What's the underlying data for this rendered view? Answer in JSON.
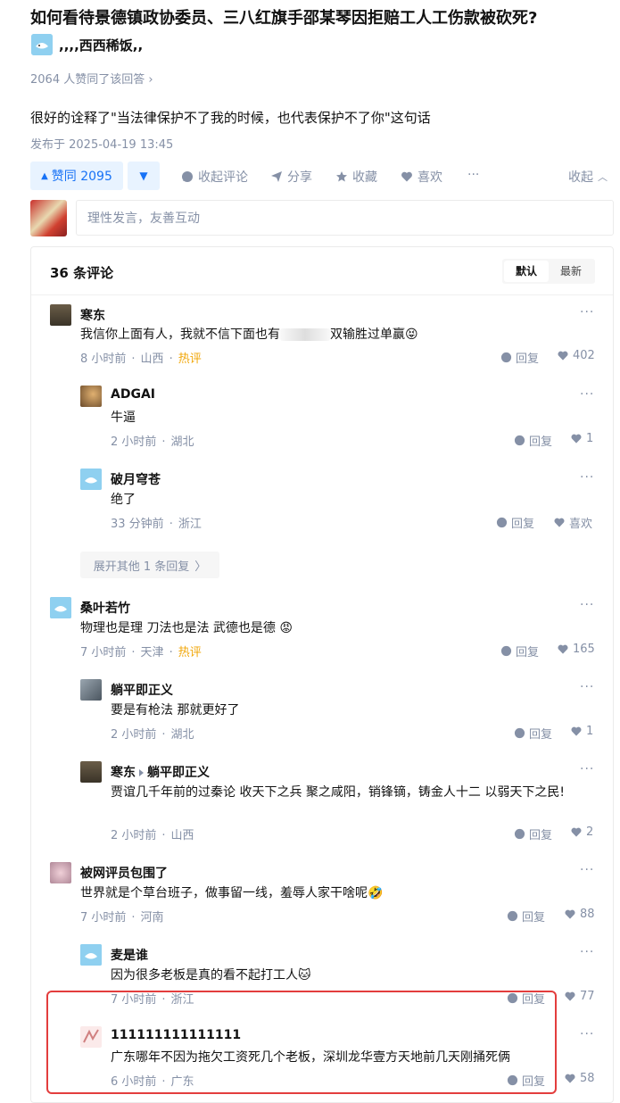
{
  "question": {
    "title": "如何看待景德镇政协委员、三八红旗手邵某琴因拒赔工人工伤款被砍死?"
  },
  "answer": {
    "author": ",,,,西西稀饭,,",
    "likes_line": "2064 人赞同了该回答",
    "content": "很好的诠释了\"当法律保护不了我的时候，也代表保护不了你\"这句话",
    "published": "发布于 2025-04-19 13:45"
  },
  "actions": {
    "vote_up": "赞同 2095",
    "collapse_comments": "收起评论",
    "share": "分享",
    "favorite": "收藏",
    "like": "喜欢",
    "more": "···",
    "fold": "收起"
  },
  "comment_input": {
    "placeholder": "理性发言，友善互动"
  },
  "comments_header": {
    "count_label": "36 条评论",
    "sort_default": "默认",
    "sort_latest": "最新"
  },
  "comments": [
    {
      "name": "寒东",
      "text_before": "我信你上面有人，我就不信下面也有",
      "text_after": "双输胜过单赢",
      "emoji": "😝",
      "time": "8 小时前",
      "region": "山西",
      "tag": "热评",
      "reply": "回复",
      "likes": "402",
      "more": "···"
    },
    {
      "name": "ADGAI",
      "text": "牛逼",
      "time": "2 小时前",
      "region": "湖北",
      "reply": "回复",
      "likes": "1",
      "more": "···"
    },
    {
      "name": "破月穹苍",
      "text": "绝了",
      "time": "33 分钟前",
      "region": "浙江",
      "reply": "回复",
      "likes": "喜欢",
      "more": "···"
    },
    {
      "expand": "展开其他 1 条回复"
    },
    {
      "name": "桑叶若竹",
      "text": "物理也是理 刀法也是法 武德也是德",
      "emoji": "😡",
      "time": "7 小时前",
      "region": "天津",
      "tag": "热评",
      "reply": "回复",
      "likes": "165",
      "more": "···"
    },
    {
      "name": "躺平即正义",
      "text": "要是有枪法 那就更好了",
      "time": "2 小时前",
      "region": "湖北",
      "reply": "回复",
      "likes": "1",
      "more": "···"
    },
    {
      "name": "寒东",
      "reply_to": "躺平即正义",
      "text": "贾谊几千年前的过秦论 收天下之兵 聚之咸阳，销锋镝，铸金人十二 以弱天下之民!",
      "time": "2 小时前",
      "region": "山西",
      "reply": "回复",
      "likes": "2",
      "more": "···"
    },
    {
      "name": "被网评员包围了",
      "text": "世界就是个草台班子，做事留一线，羞辱人家干啥呢",
      "emoji": "🤣",
      "time": "7 小时前",
      "region": "河南",
      "reply": "回复",
      "likes": "88",
      "more": "···"
    },
    {
      "name": "麦是谁",
      "text": "因为很多老板是真的看不起打工人",
      "emoji": "🐱",
      "time": "7 小时前",
      "region": "浙江",
      "reply": "回复",
      "likes": "77",
      "more": "···"
    },
    {
      "name": "111111111111111",
      "text": "广东哪年不因为拖欠工资死几个老板，深圳龙华壹方天地前几天刚捅死俩",
      "time": "6 小时前",
      "region": "广东",
      "reply": "回复",
      "likes": "58",
      "more": "···"
    }
  ],
  "colors": {
    "accent": "#1772f6",
    "hot": "#f1a70a",
    "highlight_box": "#e33d3d",
    "meta": "#8590a6"
  }
}
